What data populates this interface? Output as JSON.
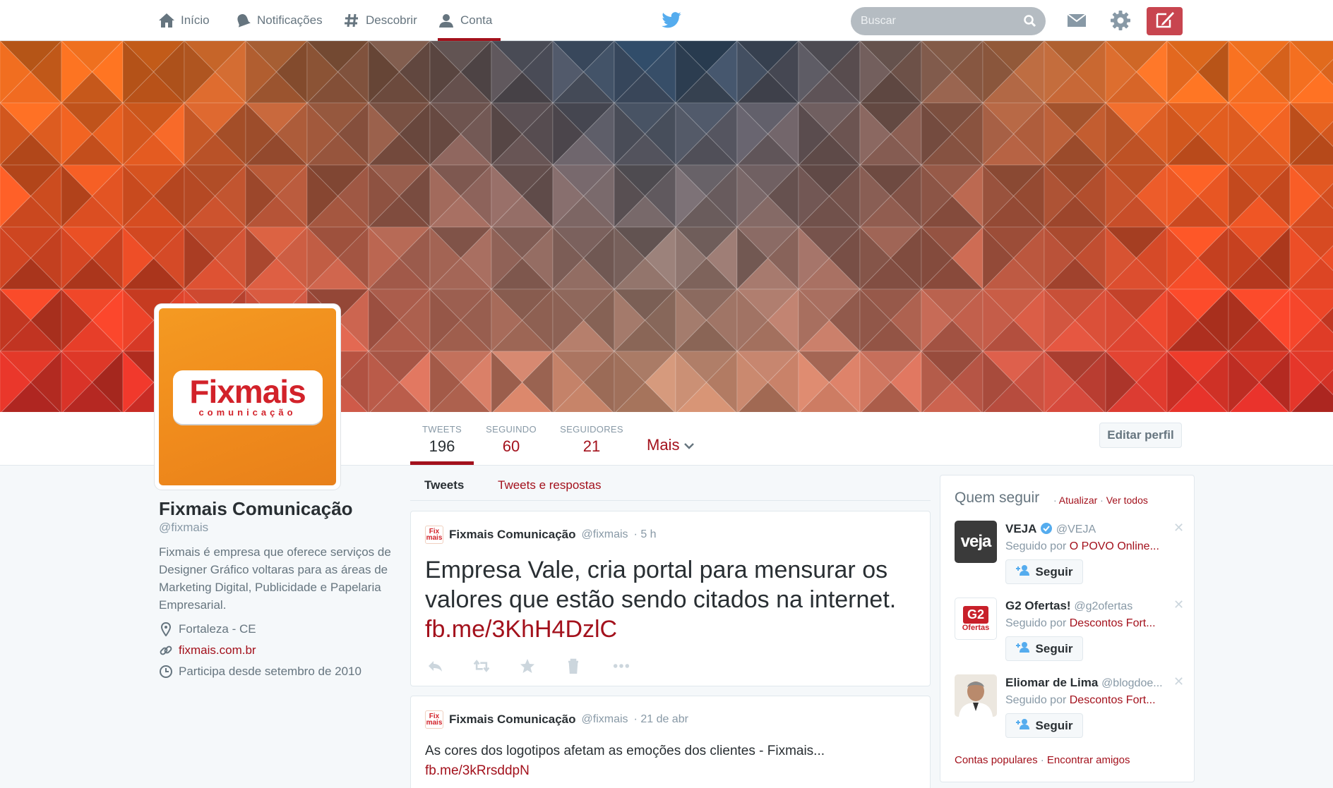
{
  "nav": {
    "home": "Início",
    "notifications": "Notificações",
    "discover": "Descobrir",
    "account": "Conta",
    "search_placeholder": "Buscar"
  },
  "profile": {
    "name": "Fixmais Comunicação",
    "handle": "@fixmais",
    "bio": "Fixmais é empresa que oferece serviços de Designer Gráfico voltaras para as áreas de Marketing Digital, Publicidade e Papelaria Empresarial.",
    "location": "Fortaleza - CE",
    "website": "fixmais.com.br",
    "joined": "Participa desde setembro de 2010",
    "logo_main": "Fixmais",
    "logo_sub": "comunicação",
    "mini_logo": "Fix mais"
  },
  "stats": {
    "tweets_label": "TWEETS",
    "tweets_value": "196",
    "following_label": "SEGUINDO",
    "following_value": "60",
    "followers_label": "SEGUIDORES",
    "followers_value": "21",
    "more_label": "Mais",
    "edit_profile": "Editar perfil"
  },
  "tabs": {
    "tweets": "Tweets",
    "replies": "Tweets e respostas"
  },
  "tweets": [
    {
      "name": "Fixmais Comunicação",
      "handle": "@fixmais",
      "time": "· 5 h",
      "text": "Empresa Vale, cria portal para mensurar os valores que estão sendo citados na internet.",
      "link": "fb.me/3KhH4DzlC"
    },
    {
      "name": "Fixmais Comunicação",
      "handle": "@fixmais",
      "time": "· 21 de abr",
      "text": "As cores dos logotipos afetam as emoções dos clientes - Fixmais...",
      "link": "fb.me/3kRrsddpN"
    }
  ],
  "who_to_follow": {
    "title": "Quem seguir",
    "refresh": "Atualizar",
    "view_all": "Ver todos",
    "dot": "·",
    "suggestions": [
      {
        "name": "VEJA",
        "handle": "@VEJA",
        "followed_by_prefix": "Seguido por",
        "followed_by": "O POVO Online...",
        "button": "Seguir",
        "avatar_text": "veja",
        "verified": true
      },
      {
        "name": "G2 Ofertas!",
        "handle": "@g2ofertas",
        "followed_by_prefix": "Seguido por",
        "followed_by": "Descontos Fort...",
        "button": "Seguir",
        "avatar_text": "G2",
        "avatar_sub": "Ofertas",
        "verified": false
      },
      {
        "name": "Eliomar de Lima",
        "handle": "@blogdoe...",
        "followed_by_prefix": "Seguido por",
        "followed_by": "Descontos Fort...",
        "button": "Seguir",
        "verified": false
      }
    ],
    "footer_popular": "Contas populares",
    "footer_find": "Encontrar amigos"
  },
  "colors": {
    "accent": "#a3111c",
    "brand_orange": "#f49a22",
    "twitter_blue": "#55acee"
  }
}
